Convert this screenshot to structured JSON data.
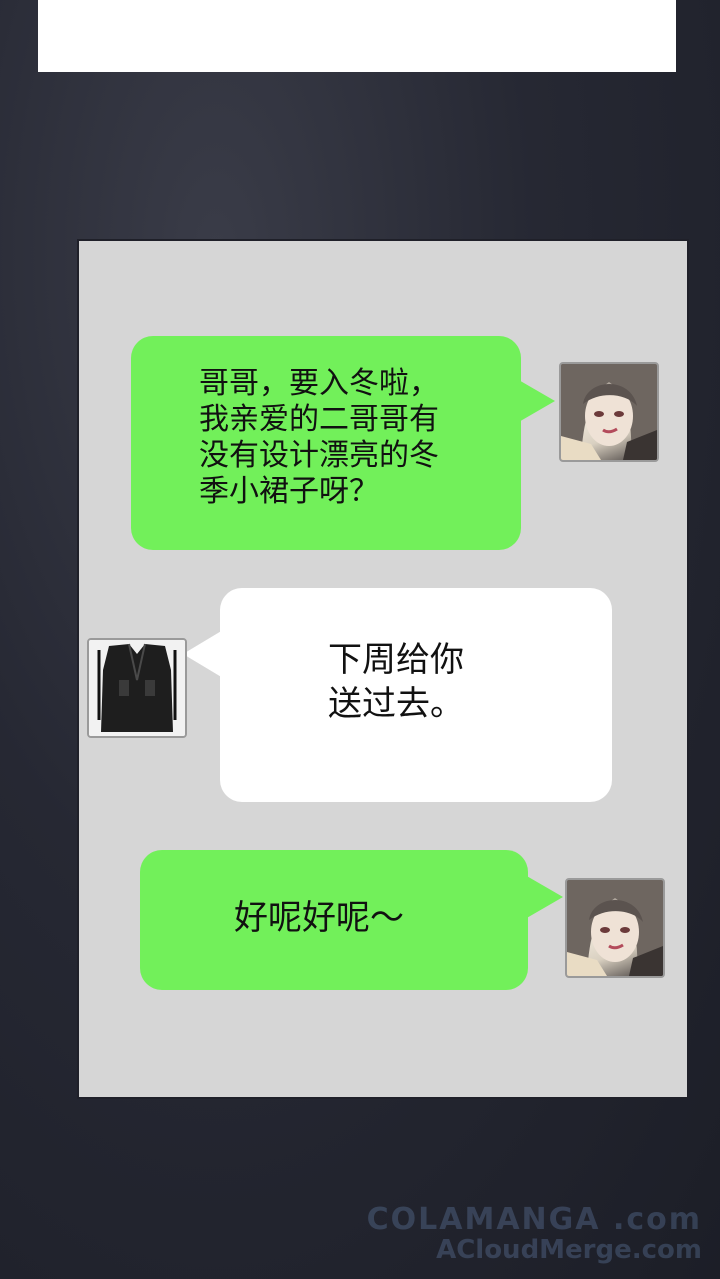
{
  "messages": [
    {
      "side": "right",
      "bubble_color": "#72f05a",
      "text": "哥哥，要入冬啦，\n我亲爱的二哥哥有\n没有设计漂亮的冬\n季小裙子呀？",
      "avatar": "girl-avatar"
    },
    {
      "side": "left",
      "bubble_color": "#ffffff",
      "text": "下周给你\n送过去。",
      "avatar": "black-coat-avatar"
    },
    {
      "side": "right",
      "bubble_color": "#72f05a",
      "text": "好呢好呢～",
      "avatar": "girl-avatar"
    }
  ],
  "watermark": {
    "line1": "COLAMANGA .com",
    "line2": "ACloudMerge.com"
  },
  "colors": {
    "background": "#262833",
    "panel": "#d6d6d6",
    "green_bubble": "#72f05a",
    "white_bubble": "#ffffff"
  }
}
